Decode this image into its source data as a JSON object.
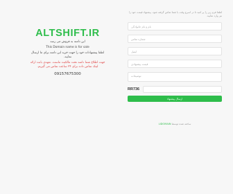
{
  "brand": {
    "title": "ALTSHIFT.IR",
    "accent_color": "#2ebd4b"
  },
  "left": {
    "for_sale_fa": "این دامنه به فروش می رسد",
    "for_sale_en": "This Domain name is for sale",
    "offer_text": "لطفا پیشنهادات خود را جهت خرید این دامنه برای ما ارسال نمایید.",
    "warning_text": "جهت اطلاع شما دامنه تحت مالکیت ماست. تعهدی بابت ارائه لینک تماس داده برای ۲۴ ساعت تماس می گیریم.",
    "phone": "09157675300"
  },
  "form": {
    "intro": "لطفا فرم زیر را پر کنید تا در اسرع وقت با شما تماس گرفته شود. پیشنهاد قیمت خود را نیز وارد نمایید.",
    "name_placeholder": "نام و نام خانوادگی",
    "phone_placeholder": "شماره تماس",
    "email_placeholder": "ایمیل",
    "price_placeholder": "قیمت پیشنهادی",
    "message_placeholder": "توضیحات",
    "captcha_code": "RR736",
    "submit_label": "ارسال پیشنهاد"
  },
  "footer": {
    "text": "ساخته شده توسط",
    "link_text": "LIDOMAIN"
  }
}
